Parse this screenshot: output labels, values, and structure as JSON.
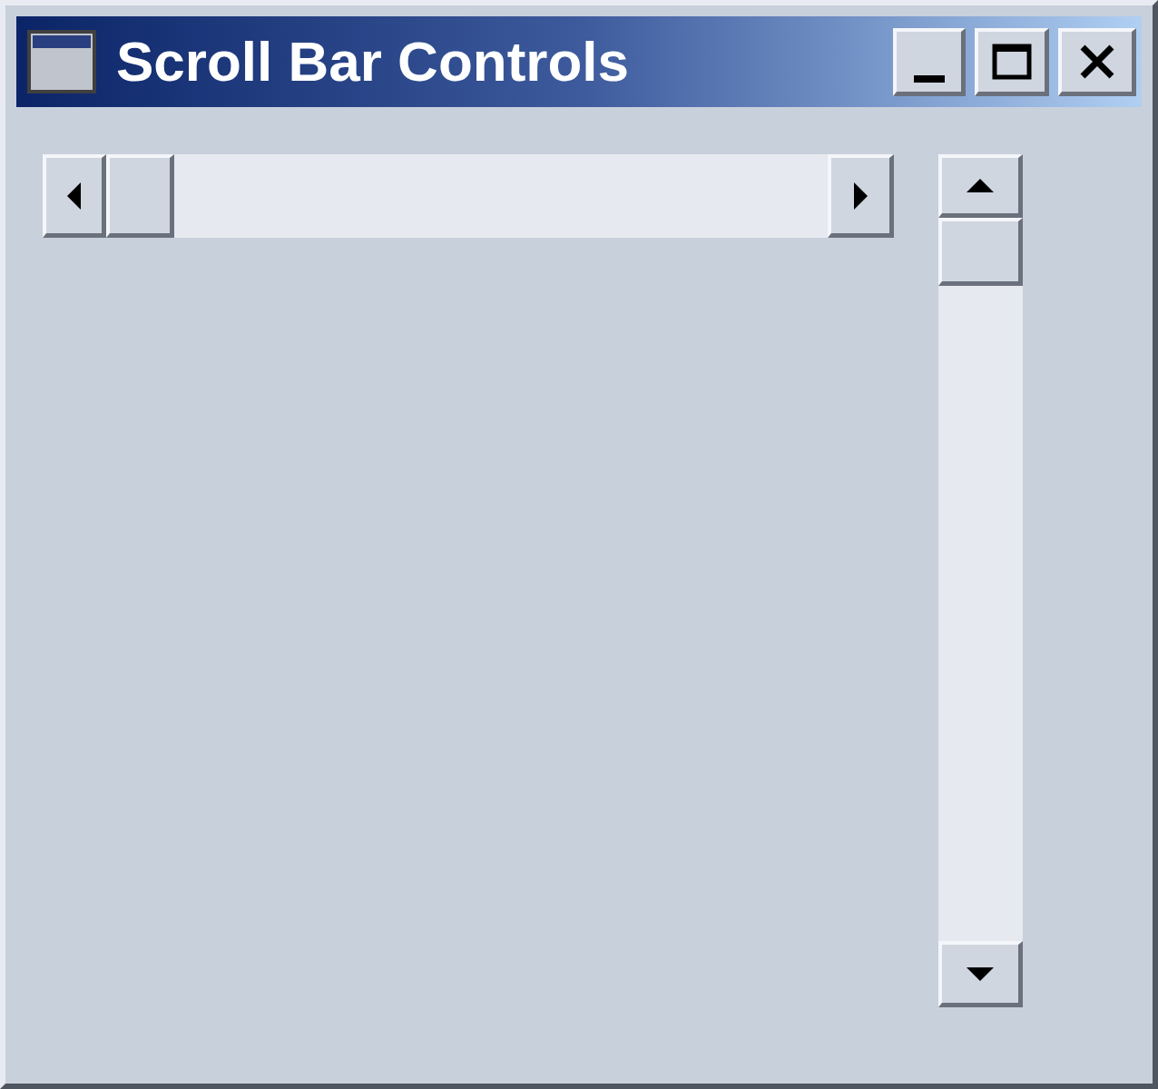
{
  "window": {
    "title": "Scroll Bar Controls"
  },
  "scroll_bars": [
    {
      "kind": "horizontal"
    },
    {
      "kind": "vertical"
    }
  ]
}
